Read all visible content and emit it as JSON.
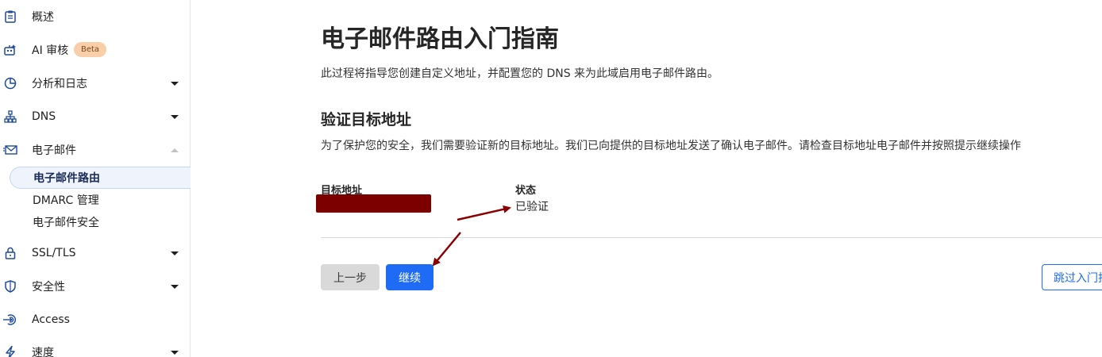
{
  "sidebar": {
    "items": [
      {
        "label": "概述",
        "icon": "clipboard-icon"
      },
      {
        "label": "AI 审核",
        "icon": "robot-icon",
        "badge": "Beta"
      },
      {
        "label": "分析和日志",
        "icon": "pie-chart-icon"
      },
      {
        "label": "DNS",
        "icon": "network-icon"
      },
      {
        "label": "电子邮件",
        "icon": "envelope-icon"
      },
      {
        "label": "SSL/TLS",
        "icon": "lock-icon"
      },
      {
        "label": "安全性",
        "icon": "shield-icon"
      },
      {
        "label": "Access",
        "icon": "access-icon"
      },
      {
        "label": "速度",
        "icon": "lightning-icon"
      }
    ],
    "email_sub": [
      {
        "label": "电子邮件路由",
        "active": true
      },
      {
        "label": "DMARC 管理"
      },
      {
        "label": "电子邮件安全"
      }
    ]
  },
  "main": {
    "title": "电子邮件路由入门指南",
    "description": "此过程将指导您创建自定义地址，并配置您的 DNS 来为此域启用电子邮件路由。",
    "section_title": "验证目标地址",
    "section_desc": "为了保护您的安全，我们需要验证新的目标地址。我们已向提供的目标地址发送了确认电子邮件。请检查目标地址电子邮件并按照提示继续操作",
    "columns": {
      "address": "目标地址",
      "status": "状态"
    },
    "status_value": "已验证",
    "buttons": {
      "back": "上一步",
      "continue": "继续",
      "skip": "跳过入门指南"
    }
  },
  "colors": {
    "accent": "#1f6bf5",
    "annotation": "#8b0000",
    "redaction": "#7d0000",
    "beta_bg": "#f8cfa8"
  }
}
